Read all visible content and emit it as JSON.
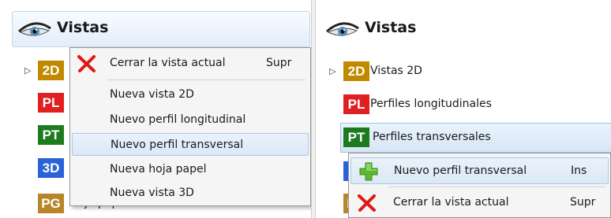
{
  "left": {
    "title": "Vistas",
    "tree": [
      {
        "badge": "2D",
        "color": "#c08a00",
        "label": ""
      },
      {
        "badge": "PL",
        "color": "#e02020",
        "label": ""
      },
      {
        "badge": "PT",
        "color": "#1e7a1e",
        "label": ""
      },
      {
        "badge": "3D",
        "color": "#2a62d8",
        "label": ""
      },
      {
        "badge": "PG",
        "color": "#b8862a",
        "label": "Hoja papel"
      }
    ],
    "menu": {
      "items": [
        {
          "label": "Cerrar la vista actual",
          "shortcut": "Supr",
          "icon": "close-x-icon"
        },
        {
          "label": "Nueva vista 2D",
          "shortcut": ""
        },
        {
          "label": "Nuevo perfil longitudinal",
          "shortcut": ""
        },
        {
          "label": "Nuevo perfil transversal",
          "shortcut": ""
        },
        {
          "label": "Nueva hoja papel",
          "shortcut": ""
        },
        {
          "label": "Nueva vista 3D",
          "shortcut": ""
        }
      ],
      "highlighted_index": 3
    }
  },
  "right": {
    "title": "Vistas",
    "tree": [
      {
        "badge": "2D",
        "color": "#c08a00",
        "label": "Vistas 2D"
      },
      {
        "badge": "PL",
        "color": "#e02020",
        "label": "Perfiles longitudinales"
      },
      {
        "badge": "PT",
        "color": "#1e7a1e",
        "label": "Perfiles transversales"
      },
      {
        "badge": "3D",
        "color": "#2a62d8",
        "label": ""
      },
      {
        "badge": "PG",
        "color": "#b8862a",
        "label": ""
      }
    ],
    "menu": {
      "items": [
        {
          "label": "Nuevo perfil transversal",
          "shortcut": "Ins",
          "icon": "add-plus-icon"
        },
        {
          "label": "Cerrar la vista actual",
          "shortcut": "Supr",
          "icon": "close-x-icon"
        }
      ],
      "highlighted_index": 0
    }
  }
}
